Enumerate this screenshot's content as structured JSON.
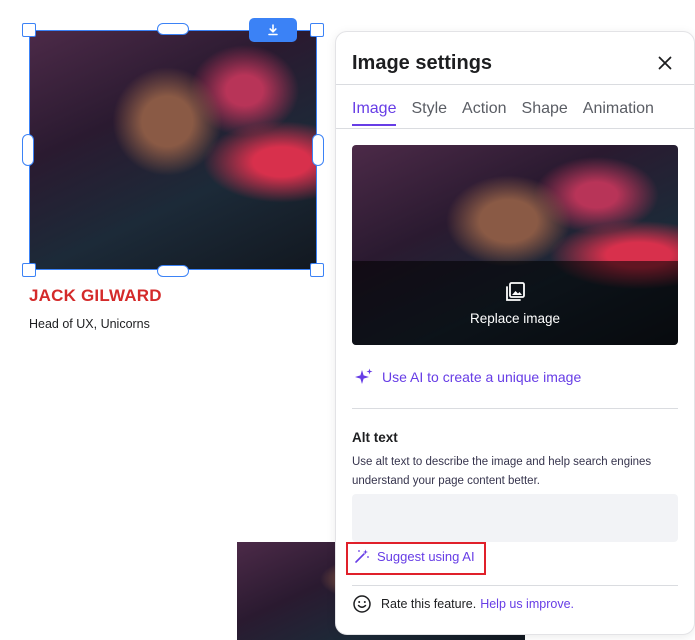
{
  "canvas": {
    "person_name": "JACK GILWARD",
    "person_role": "Head of UX, Unicorns"
  },
  "panel": {
    "title": "Image settings",
    "tabs": [
      {
        "label": "Image",
        "active": true
      },
      {
        "label": "Style",
        "active": false
      },
      {
        "label": "Action",
        "active": false
      },
      {
        "label": "Shape",
        "active": false
      },
      {
        "label": "Animation",
        "active": false
      }
    ],
    "replace_label": "Replace image",
    "ai_create_label": "Use AI to create a unique image",
    "alt_text": {
      "title": "Alt text",
      "description": "Use alt text to describe the image and help search engines understand your page content better.",
      "value": ""
    },
    "suggest_label": "Suggest using AI",
    "rate_text": "Rate this feature.",
    "help_link": "Help us improve."
  },
  "icons": {
    "download": "download-icon",
    "close": "close-icon",
    "replace": "image-gallery-icon",
    "sparkle": "sparkle-icon",
    "magic_wand": "magic-wand-icon",
    "smiley": "smiley-icon"
  },
  "colors": {
    "accent": "#673de6",
    "selection": "#3b82f6",
    "name_red": "#d42a2a",
    "highlight_red": "#e0202a"
  }
}
